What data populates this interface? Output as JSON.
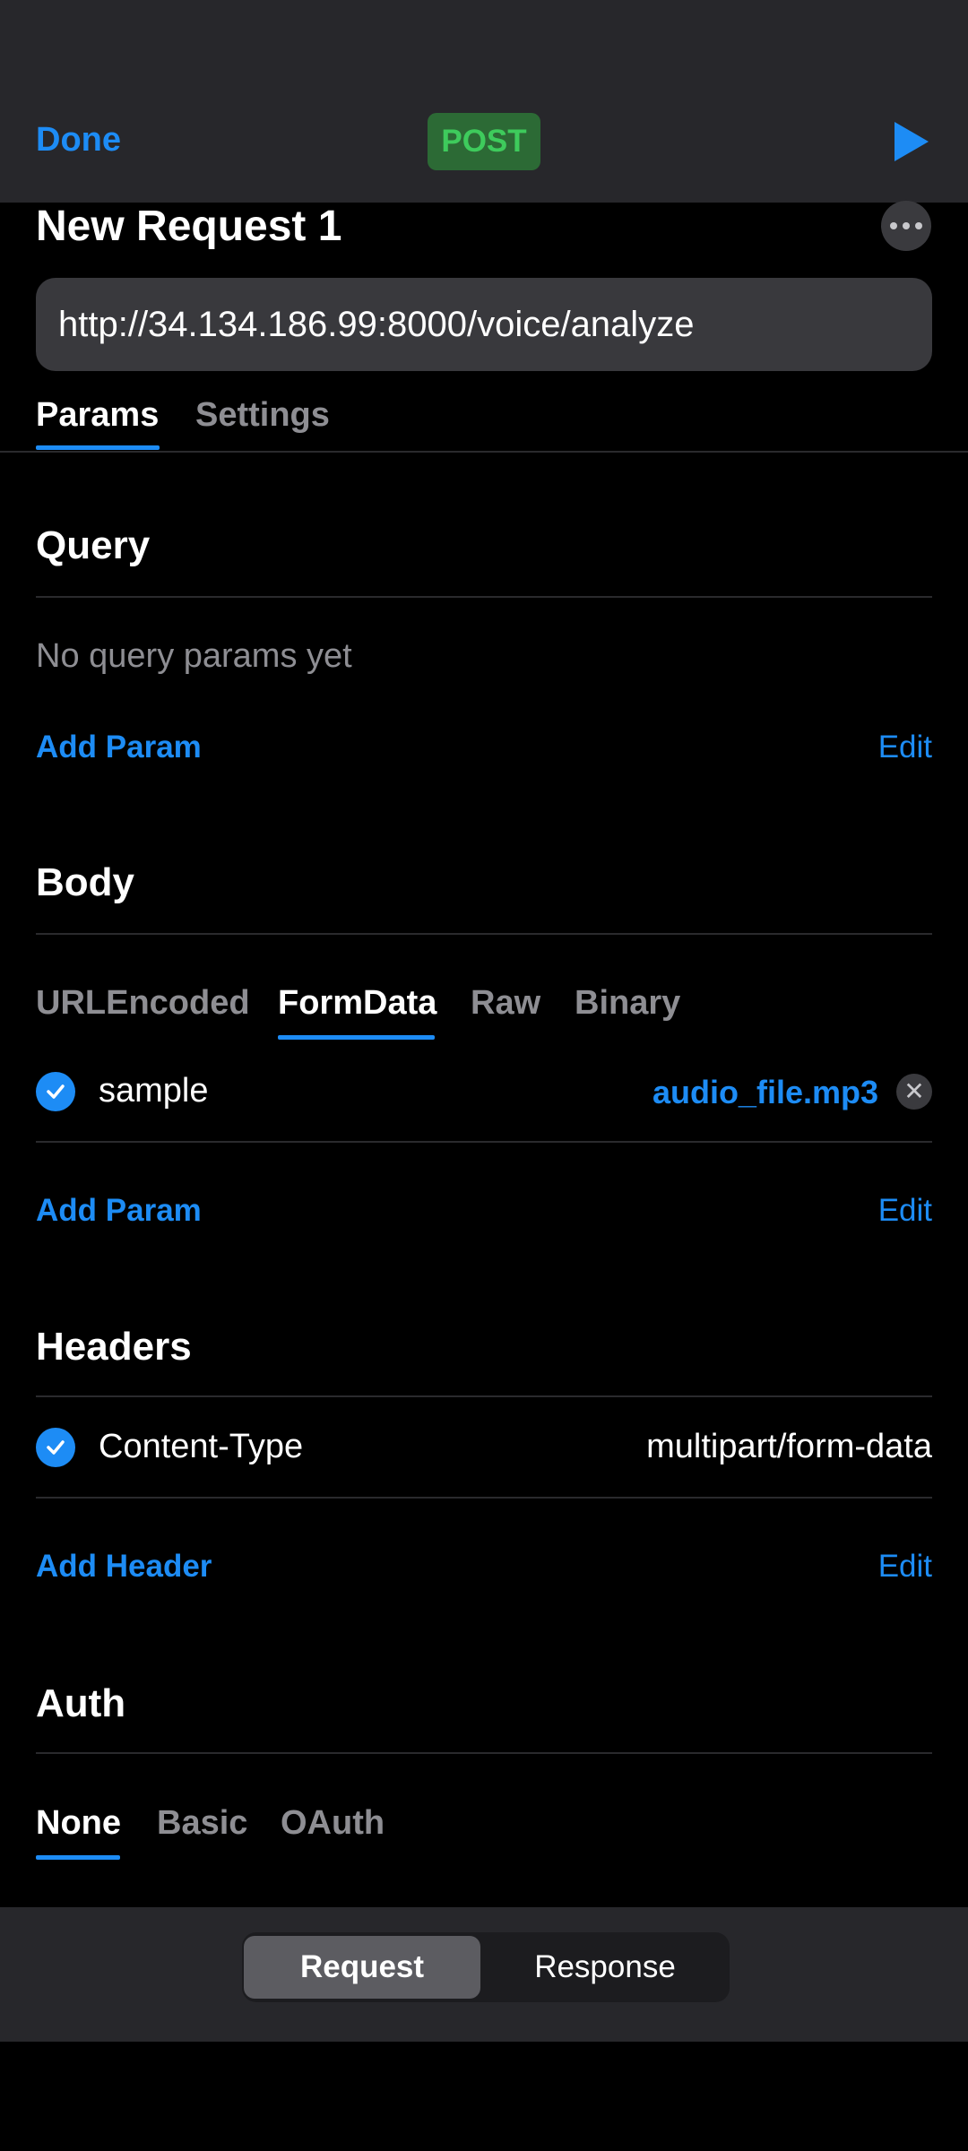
{
  "nav": {
    "done_label": "Done",
    "method": "POST",
    "send_icon": "play-icon"
  },
  "request": {
    "title": "New Request 1",
    "more_icon": "more-horizontal-icon",
    "url": "http://34.134.186.99:8000/voice/analyze"
  },
  "main_tabs": {
    "params": "Params",
    "settings": "Settings",
    "active": "Params"
  },
  "query": {
    "title": "Query",
    "empty_text": "No query params yet",
    "add_label": "Add Param",
    "edit_label": "Edit"
  },
  "body": {
    "title": "Body",
    "tabs": [
      "URLEncoded",
      "FormData",
      "Raw",
      "Binary"
    ],
    "active_tab": "FormData",
    "params": [
      {
        "enabled": true,
        "key": "sample",
        "value": "audio_file.mp3"
      }
    ],
    "add_label": "Add Param",
    "edit_label": "Edit"
  },
  "headers": {
    "title": "Headers",
    "items": [
      {
        "enabled": true,
        "key": "Content-Type",
        "value": "multipart/form-data"
      }
    ],
    "add_label": "Add Header",
    "edit_label": "Edit"
  },
  "auth": {
    "title": "Auth",
    "tabs": [
      "None",
      "Basic",
      "OAuth"
    ],
    "active_tab": "None"
  },
  "bottom_segment": {
    "request": "Request",
    "response": "Response",
    "active": "Request"
  },
  "colors": {
    "accent": "#1d8cf5",
    "method_bg": "#2c6a35",
    "method_text": "#3ecb5c",
    "bar_bg": "#27272b"
  }
}
